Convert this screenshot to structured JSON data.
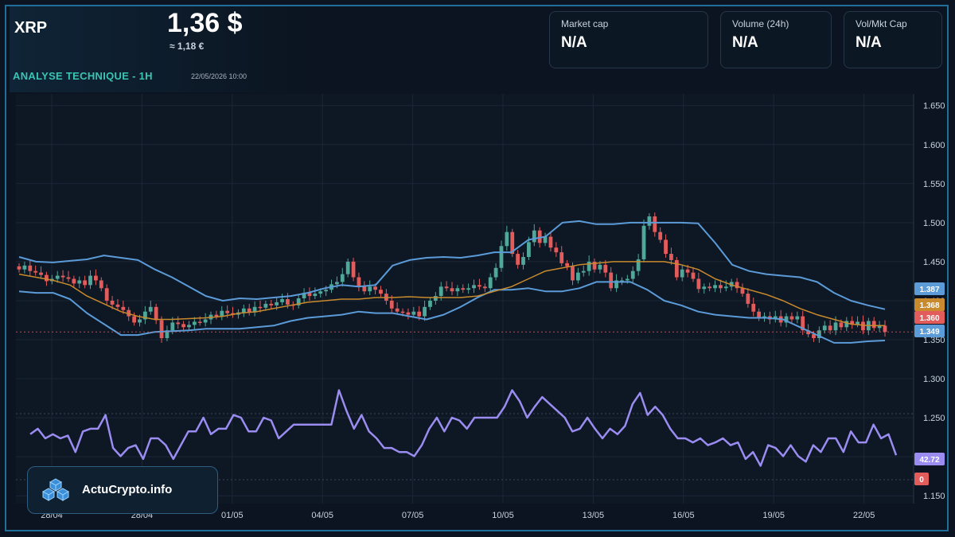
{
  "header": {
    "symbol": "XRP",
    "price": "1,36 $",
    "price_eur": "≈ 1,18 €",
    "analysis_label": "ANALYSE TECHNIQUE - 1H",
    "datetime": "22/05/2026 10:00"
  },
  "stats": [
    {
      "label": "Market cap",
      "value": "N/A"
    },
    {
      "label": "Volume (24h)",
      "value": "N/A"
    },
    {
      "label": "Vol/Mkt Cap",
      "value": "N/A"
    }
  ],
  "brand": {
    "name": "ActuCrypto.info"
  },
  "colors": {
    "bg": "#0b1420",
    "up": "#4fa89a",
    "down": "#e25c5c",
    "bollinger": "#5b9bd8",
    "ma": "#c88a2c",
    "rsi": "#9a8cf0",
    "accent": "#37c6b3"
  },
  "chart_data": {
    "type": "candlestick",
    "y_ticks": [
      "1.650",
      "1.600",
      "1.550",
      "1.500",
      "1.450",
      "1.400",
      "1.350",
      "1.300",
      "1.250",
      "1.200",
      "1.150"
    ],
    "ylim": [
      1.14,
      1.665
    ],
    "x_ticks": [
      "28/04",
      "28/04",
      "01/05",
      "04/05",
      "07/05",
      "10/05",
      "13/05",
      "16/05",
      "19/05",
      "22/05"
    ],
    "price_labels": [
      {
        "text": "1.387",
        "value": 1.387,
        "color": "#5b9bd8"
      },
      {
        "text": "1.368",
        "value": 1.368,
        "color": "#c88a2c"
      },
      {
        "text": "1.360",
        "value": 1.36,
        "color": "#e25c5c"
      },
      {
        "text": "1.349",
        "value": 1.349,
        "color": "#5b9bd8"
      }
    ],
    "rsi_labels": [
      {
        "text": "42.72",
        "value": 42.72,
        "color": "#9a8cf0"
      },
      {
        "text": "0",
        "value": 0,
        "color": "#e25c5c"
      }
    ],
    "close": [
      1.44,
      1.445,
      1.438,
      1.436,
      1.433,
      1.425,
      1.428,
      1.432,
      1.43,
      1.428,
      1.422,
      1.426,
      1.42,
      1.432,
      1.426,
      1.416,
      1.4,
      1.395,
      1.392,
      1.388,
      1.38,
      1.372,
      1.376,
      1.386,
      1.392,
      1.375,
      1.352,
      1.362,
      1.372,
      1.37,
      1.366,
      1.369,
      1.373,
      1.372,
      1.376,
      1.382,
      1.38,
      1.387,
      1.384,
      1.382,
      1.385,
      1.39,
      1.385,
      1.392,
      1.391,
      1.396,
      1.394,
      1.398,
      1.402,
      1.395,
      1.394,
      1.403,
      1.41,
      1.406,
      1.409,
      1.412,
      1.414,
      1.421,
      1.424,
      1.434,
      1.45,
      1.43,
      1.418,
      1.412,
      1.418,
      1.414,
      1.409,
      1.4,
      1.39,
      1.386,
      1.385,
      1.382,
      1.386,
      1.38,
      1.392,
      1.4,
      1.406,
      1.418,
      1.416,
      1.412,
      1.416,
      1.414,
      1.416,
      1.42,
      1.418,
      1.416,
      1.43,
      1.442,
      1.47,
      1.488,
      1.46,
      1.446,
      1.456,
      1.475,
      1.49,
      1.474,
      1.482,
      1.468,
      1.462,
      1.448,
      1.444,
      1.426,
      1.436,
      1.438,
      1.45,
      1.44,
      1.446,
      1.436,
      1.416,
      1.426,
      1.426,
      1.428,
      1.438,
      1.453,
      1.496,
      1.508,
      1.488,
      1.478,
      1.46,
      1.452,
      1.43,
      1.44,
      1.436,
      1.428,
      1.415,
      1.418,
      1.416,
      1.42,
      1.416,
      1.418,
      1.424,
      1.416,
      1.409,
      1.396,
      1.386,
      1.378,
      1.38,
      1.376,
      1.38,
      1.372,
      1.38,
      1.376,
      1.38,
      1.362,
      1.357,
      1.352,
      1.362,
      1.368,
      1.362,
      1.372,
      1.366,
      1.374,
      1.37,
      1.373,
      1.362,
      1.374,
      1.365,
      1.368,
      1.36
    ],
    "bollinger_upper": [
      1.456,
      1.45,
      1.449,
      1.451,
      1.453,
      1.458,
      1.455,
      1.452,
      1.44,
      1.43,
      1.418,
      1.406,
      1.4,
      1.403,
      1.402,
      1.404,
      1.406,
      1.41,
      1.416,
      1.42,
      1.418,
      1.42,
      1.445,
      1.452,
      1.455,
      1.456,
      1.455,
      1.458,
      1.462,
      1.462,
      1.478,
      1.482,
      1.5,
      1.502,
      1.498,
      1.498,
      1.5,
      1.5,
      1.5,
      1.5,
      1.499,
      1.474,
      1.446,
      1.438,
      1.434,
      1.432,
      1.43,
      1.424,
      1.41,
      1.4,
      1.394,
      1.389
    ],
    "bollinger_lower": [
      1.412,
      1.41,
      1.41,
      1.402,
      1.384,
      1.37,
      1.356,
      1.356,
      1.36,
      1.361,
      1.362,
      1.364,
      1.364,
      1.364,
      1.366,
      1.368,
      1.374,
      1.378,
      1.38,
      1.382,
      1.386,
      1.384,
      1.384,
      1.38,
      1.376,
      1.382,
      1.392,
      1.404,
      1.414,
      1.414,
      1.416,
      1.412,
      1.412,
      1.416,
      1.424,
      1.424,
      1.424,
      1.414,
      1.4,
      1.394,
      1.386,
      1.382,
      1.38,
      1.378,
      1.378,
      1.376,
      1.366,
      1.356,
      1.346,
      1.346,
      1.348,
      1.349
    ],
    "ma": [
      1.434,
      1.43,
      1.426,
      1.42,
      1.406,
      1.396,
      1.386,
      1.38,
      1.376,
      1.376,
      1.377,
      1.378,
      1.38,
      1.384,
      1.386,
      1.39,
      1.394,
      1.398,
      1.4,
      1.402,
      1.402,
      1.404,
      1.404,
      1.405,
      1.404,
      1.404,
      1.404,
      1.406,
      1.412,
      1.418,
      1.428,
      1.438,
      1.442,
      1.446,
      1.448,
      1.45,
      1.45,
      1.45,
      1.45,
      1.446,
      1.44,
      1.428,
      1.42,
      1.414,
      1.408,
      1.4,
      1.39,
      1.382,
      1.376,
      1.37,
      1.368,
      1.368
    ],
    "rsi": [
      58,
      62,
      55,
      58,
      55,
      57,
      45,
      60,
      62,
      62,
      72,
      48,
      42,
      48,
      50,
      40,
      55,
      55,
      50,
      40,
      50,
      60,
      60,
      70,
      58,
      62,
      62,
      72,
      70,
      60,
      60,
      70,
      68,
      55,
      60,
      65,
      65,
      65,
      65,
      65,
      65,
      90,
      75,
      62,
      72,
      60,
      55,
      48,
      48,
      45,
      45,
      42,
      50,
      62,
      70,
      60,
      70,
      68,
      62,
      70,
      70,
      70,
      70,
      78,
      90,
      82,
      70,
      78,
      85,
      80,
      75,
      70,
      60,
      62,
      70,
      62,
      55,
      62,
      58,
      64,
      80,
      88,
      72,
      78,
      72,
      62,
      55,
      55,
      52,
      55,
      50,
      52,
      55,
      50,
      52,
      40,
      45,
      35,
      50,
      48,
      42,
      50,
      42,
      38,
      50,
      45,
      55,
      55,
      45,
      60,
      52,
      52,
      65,
      55,
      58,
      42.72
    ]
  }
}
